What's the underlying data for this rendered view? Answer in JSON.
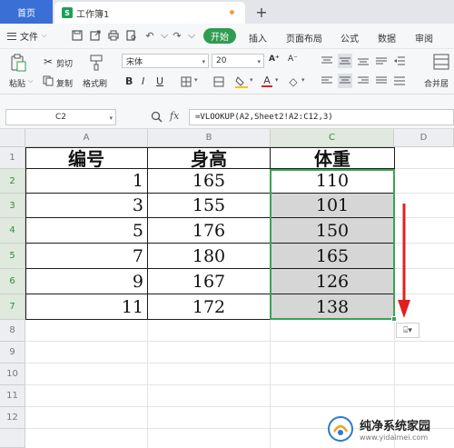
{
  "tabs": {
    "home_label": "首页",
    "doc_label": "工作簿1",
    "doc_icon_letter": "S",
    "add_label": "+"
  },
  "menu": {
    "file_label": "文件",
    "start_label": "开始",
    "items": [
      "插入",
      "页面布局",
      "公式",
      "数据",
      "审阅"
    ]
  },
  "ribbon": {
    "cut_label": "剪切",
    "copy_label": "复制",
    "paste_label": "粘贴",
    "format_painter_label": "格式刷",
    "font_name": "宋体",
    "font_size": "20",
    "merge_label": "合并居"
  },
  "formula_bar": {
    "cell_ref": "C2",
    "fx_label": "fx",
    "formula": "=VLOOKUP(A2,Sheet2!A2:C12,3)"
  },
  "grid": {
    "columns": [
      "A",
      "B",
      "C",
      "D"
    ],
    "rows": [
      "1",
      "2",
      "3",
      "4",
      "5",
      "6",
      "7",
      "8",
      "9",
      "10",
      "11",
      "12"
    ],
    "headers": [
      "编号",
      "身高",
      "体重"
    ],
    "data": [
      [
        "1",
        "165",
        "110"
      ],
      [
        "3",
        "155",
        "101"
      ],
      [
        "5",
        "176",
        "150"
      ],
      [
        "7",
        "180",
        "165"
      ],
      [
        "9",
        "167",
        "126"
      ],
      [
        "11",
        "172",
        "138"
      ]
    ]
  },
  "paste_options_label": "⌸▾",
  "watermark": {
    "title": "纯净系统家园",
    "url": "www.yidaimei.com"
  },
  "colors": {
    "accent_green": "#2f9c4f",
    "selection_border": "#3aa356",
    "tab_blue": "#3a6fd6",
    "arrow_red": "#e02020"
  }
}
